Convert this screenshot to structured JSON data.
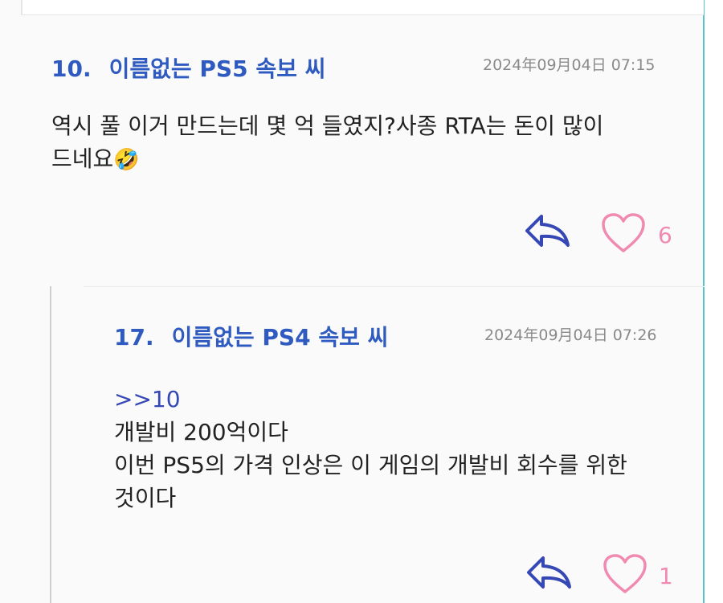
{
  "comments": [
    {
      "number": "10.",
      "author": "이름없는 PS5 속보 씨",
      "date": "2024年09月04日 07:15",
      "lines": [
        "역시 풀 이거 만드는데 몇 억 들였지?사종 RTA는 돈이 많이",
        "드네요"
      ],
      "emoji": "🤣",
      "likes": "6"
    },
    {
      "number": "17.",
      "author": "이름없는 PS4 속보 씨",
      "date": "2024年09月04日 07:26",
      "quote": ">>10",
      "lines": [
        "개발비 200억이다",
        "이번 PS5의 가격 인상은 이 게임의 개발비 회수를 위한",
        "것이다"
      ],
      "likes": "1"
    }
  ],
  "colors": {
    "accent": "#2f5bc1",
    "heart": "#f08ab0",
    "reply": "#3548b4",
    "border": "#58c3c8"
  },
  "icons": [
    "reply-arrow-icon",
    "heart-icon"
  ]
}
